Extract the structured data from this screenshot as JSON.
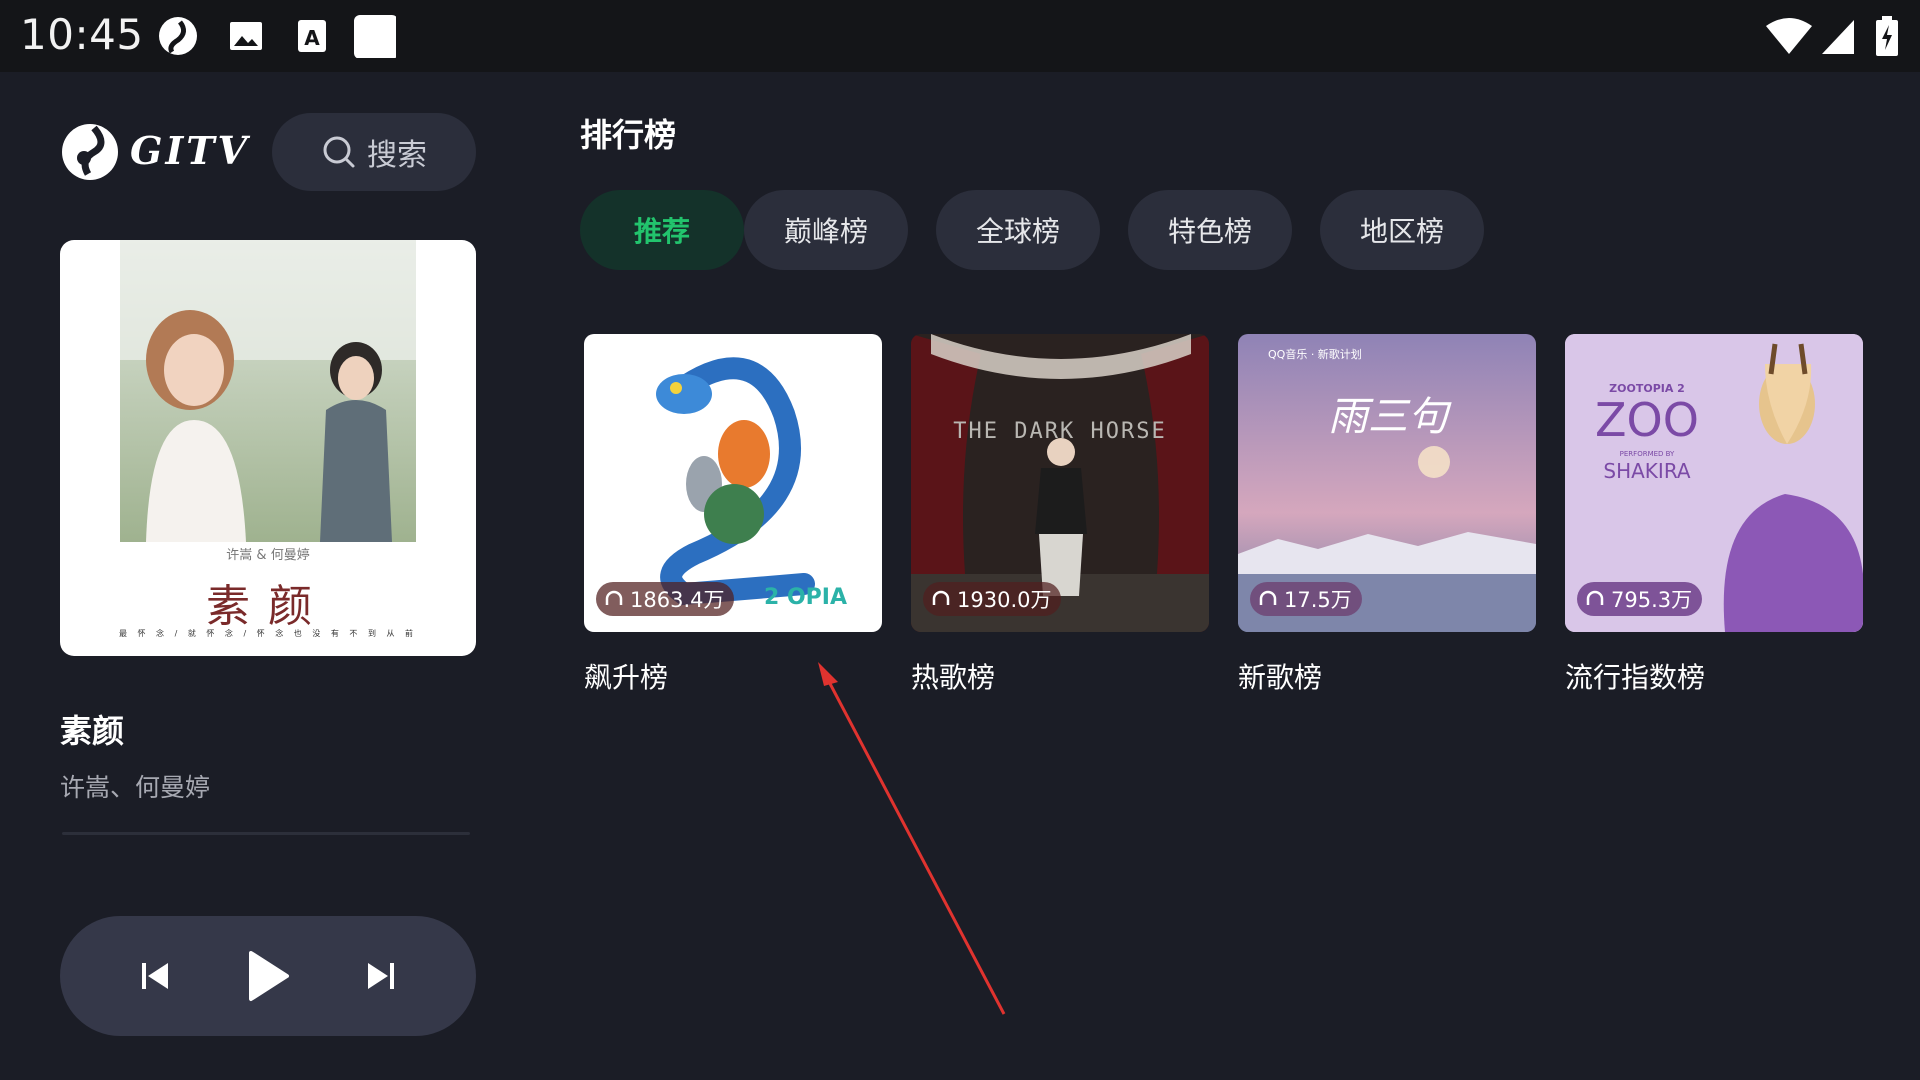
{
  "status_bar": {
    "time": "10:45",
    "left_icons": [
      "gitv-app-icon",
      "image-icon",
      "keyboard-a-icon",
      "blank-app-icon"
    ],
    "right_icons": [
      "wifi-icon",
      "signal-icon",
      "battery-charging-icon"
    ]
  },
  "sidebar": {
    "logo_text": "GITV",
    "search_label": "搜索",
    "now_playing": {
      "title": "素颜",
      "artist": "许嵩、何曼婷",
      "cover_subtitle": "许嵩 & 何曼婷",
      "cover_title": "素颜",
      "cover_tagline": "最 怀 念 / 就 怀 念 / 怀 念 也 没 有 不 到 从 前"
    },
    "controls": {
      "prev": "skip-previous-icon",
      "play": "play-icon",
      "next": "skip-next-icon"
    }
  },
  "main": {
    "section_title": "排行榜",
    "tabs": [
      {
        "label": "推荐",
        "active": true
      },
      {
        "label": "巅峰榜",
        "active": false
      },
      {
        "label": "全球榜",
        "active": false
      },
      {
        "label": "特色榜",
        "active": false
      },
      {
        "label": "地区榜",
        "active": false
      }
    ],
    "charts": [
      {
        "title": "飙升榜",
        "play_count": "1863.4万",
        "cover_text": "2 OPIA"
      },
      {
        "title": "热歌榜",
        "play_count": "1930.0万",
        "cover_text": "THE DARK HORSE"
      },
      {
        "title": "新歌榜",
        "play_count": "17.5万",
        "cover_text": "雨三句",
        "cover_brand": "QQ音乐 · 新歌计划"
      },
      {
        "title": "流行指数榜",
        "play_count": "795.3万",
        "cover_text": "ZOO",
        "cover_sub": "SHAKIRA",
        "cover_top": "ZOOTOPIA 2",
        "cover_small": "PERFORMED BY"
      }
    ]
  },
  "colors": {
    "background": "#1b1d26",
    "status_bar": "#141518",
    "pill": "#2b2e3b",
    "active_tab_text": "#22c46d",
    "annotation_arrow": "#e0332f"
  }
}
